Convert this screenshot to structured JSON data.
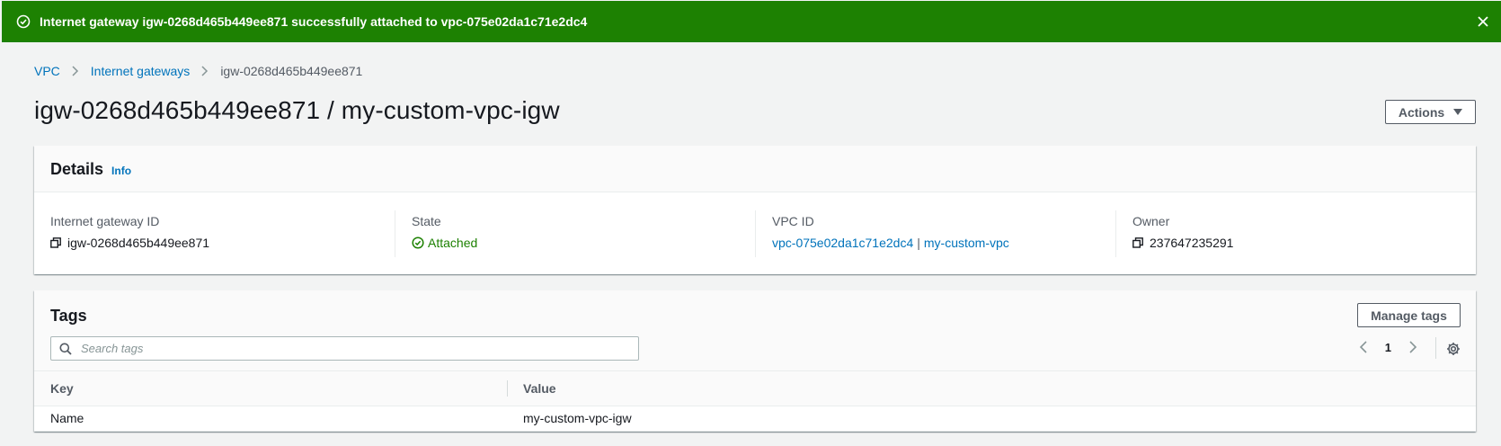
{
  "flash": {
    "message": "Internet gateway igw-0268d465b449ee871 successfully attached to vpc-075e02da1c71e2dc4",
    "icon": "check-circle-icon",
    "color": "#1d8102"
  },
  "breadcrumb": {
    "items": [
      "VPC",
      "Internet gateways",
      "igw-0268d465b449ee871"
    ]
  },
  "page": {
    "title": "igw-0268d465b449ee871 / my-custom-vpc-igw",
    "actions_label": "Actions"
  },
  "details": {
    "title": "Details",
    "info_label": "Info",
    "fields": {
      "igw_id_label": "Internet gateway ID",
      "igw_id_value": "igw-0268d465b449ee871",
      "state_label": "State",
      "state_value": "Attached",
      "vpc_id_label": "VPC ID",
      "vpc_id_value": "vpc-075e02da1c71e2dc4",
      "vpc_separator": "|",
      "vpc_name_value": "my-custom-vpc",
      "owner_label": "Owner",
      "owner_value": "237647235291"
    }
  },
  "tags": {
    "title": "Tags",
    "manage_label": "Manage tags",
    "search_placeholder": "Search tags",
    "current_page": "1",
    "columns": [
      "Key",
      "Value"
    ],
    "rows": [
      {
        "key": "Name",
        "value": "my-custom-vpc-igw"
      }
    ]
  },
  "colors": {
    "link": "#0073bb",
    "success": "#1d8102"
  }
}
